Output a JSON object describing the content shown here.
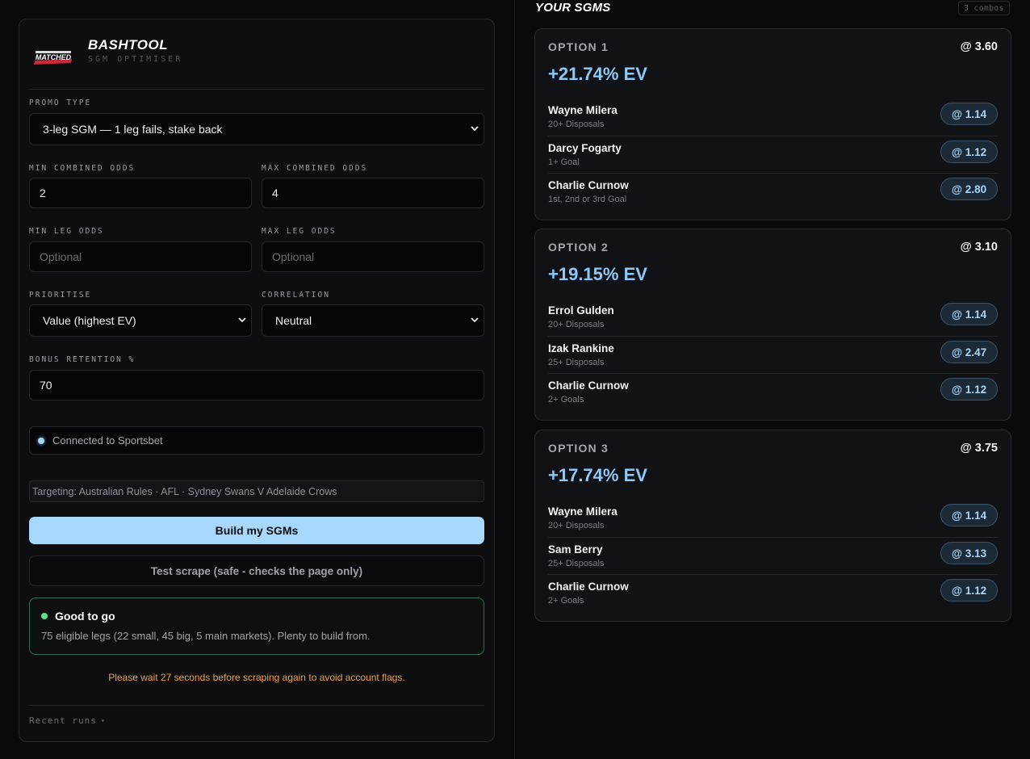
{
  "brand": {
    "title": "BASHTOOL",
    "subtitle": "SGM OPTIMISER",
    "logo_text": "MATCHED"
  },
  "form": {
    "promo_type": {
      "label": "PROMO TYPE",
      "value": "3-leg SGM — 1 leg fails, stake back"
    },
    "min_combined_odds": {
      "label": "MIN COMBINED ODDS",
      "value": "2"
    },
    "max_combined_odds": {
      "label": "MAX COMBINED ODDS",
      "value": "4"
    },
    "min_leg_odds": {
      "label": "MIN LEG ODDS",
      "placeholder": "Optional"
    },
    "max_leg_odds": {
      "label": "MAX LEG ODDS",
      "placeholder": "Optional"
    },
    "prioritise": {
      "label": "PRIORITISE",
      "value": "Value (highest EV)"
    },
    "correlation": {
      "label": "CORRELATION",
      "value": "Neutral"
    },
    "bonus_retention": {
      "label": "BONUS RETENTION %",
      "value": "70"
    }
  },
  "connection": {
    "text": "Connected to Sportsbet"
  },
  "targeting": {
    "text": "Targeting: Australian Rules · AFL · Sydney Swans V Adelaide Crows"
  },
  "actions": {
    "build_label": "Build my SGMs",
    "test_label": "Test scrape (safe - checks the page only)"
  },
  "status": {
    "title": "Good to go",
    "text": "75 eligible legs (22 small, 45 big, 5 main markets). Plenty to build from."
  },
  "warning": "Please wait 27 seconds before scraping again to avoid account flags.",
  "recent_runs_label": "Recent runs",
  "results": {
    "title": "YOUR SGMS",
    "combos_badge": "3 combos",
    "options": [
      {
        "label": "OPTION 1",
        "odds": "@ 3.60",
        "ev": "+21.74% EV",
        "legs": [
          {
            "name": "Wayne Milera",
            "market": "20+ Disposals",
            "odds": "@ 1.14"
          },
          {
            "name": "Darcy Fogarty",
            "market": "1+ Goal",
            "odds": "@ 1.12"
          },
          {
            "name": "Charlie Curnow",
            "market": "1st, 2nd or 3rd Goal",
            "odds": "@ 2.80"
          }
        ]
      },
      {
        "label": "OPTION 2",
        "odds": "@ 3.10",
        "ev": "+19.15% EV",
        "legs": [
          {
            "name": "Errol Gulden",
            "market": "20+ Disposals",
            "odds": "@ 1.14"
          },
          {
            "name": "Izak Rankine",
            "market": "25+ Disposals",
            "odds": "@ 2.47"
          },
          {
            "name": "Charlie Curnow",
            "market": "2+ Goals",
            "odds": "@ 1.12"
          }
        ]
      },
      {
        "label": "OPTION 3",
        "odds": "@ 3.75",
        "ev": "+17.74% EV",
        "legs": [
          {
            "name": "Wayne Milera",
            "market": "20+ Disposals",
            "odds": "@ 1.14"
          },
          {
            "name": "Sam Berry",
            "market": "25+ Disposals",
            "odds": "@ 3.13"
          },
          {
            "name": "Charlie Curnow",
            "market": "2+ Goals",
            "odds": "@ 1.12"
          }
        ]
      }
    ]
  },
  "colors": {
    "accent": "#a7d8fb",
    "ev_text": "#8cc9f7",
    "success": "#5ee08c",
    "warning": "#f0a03a",
    "background": "#0a0a0c"
  }
}
